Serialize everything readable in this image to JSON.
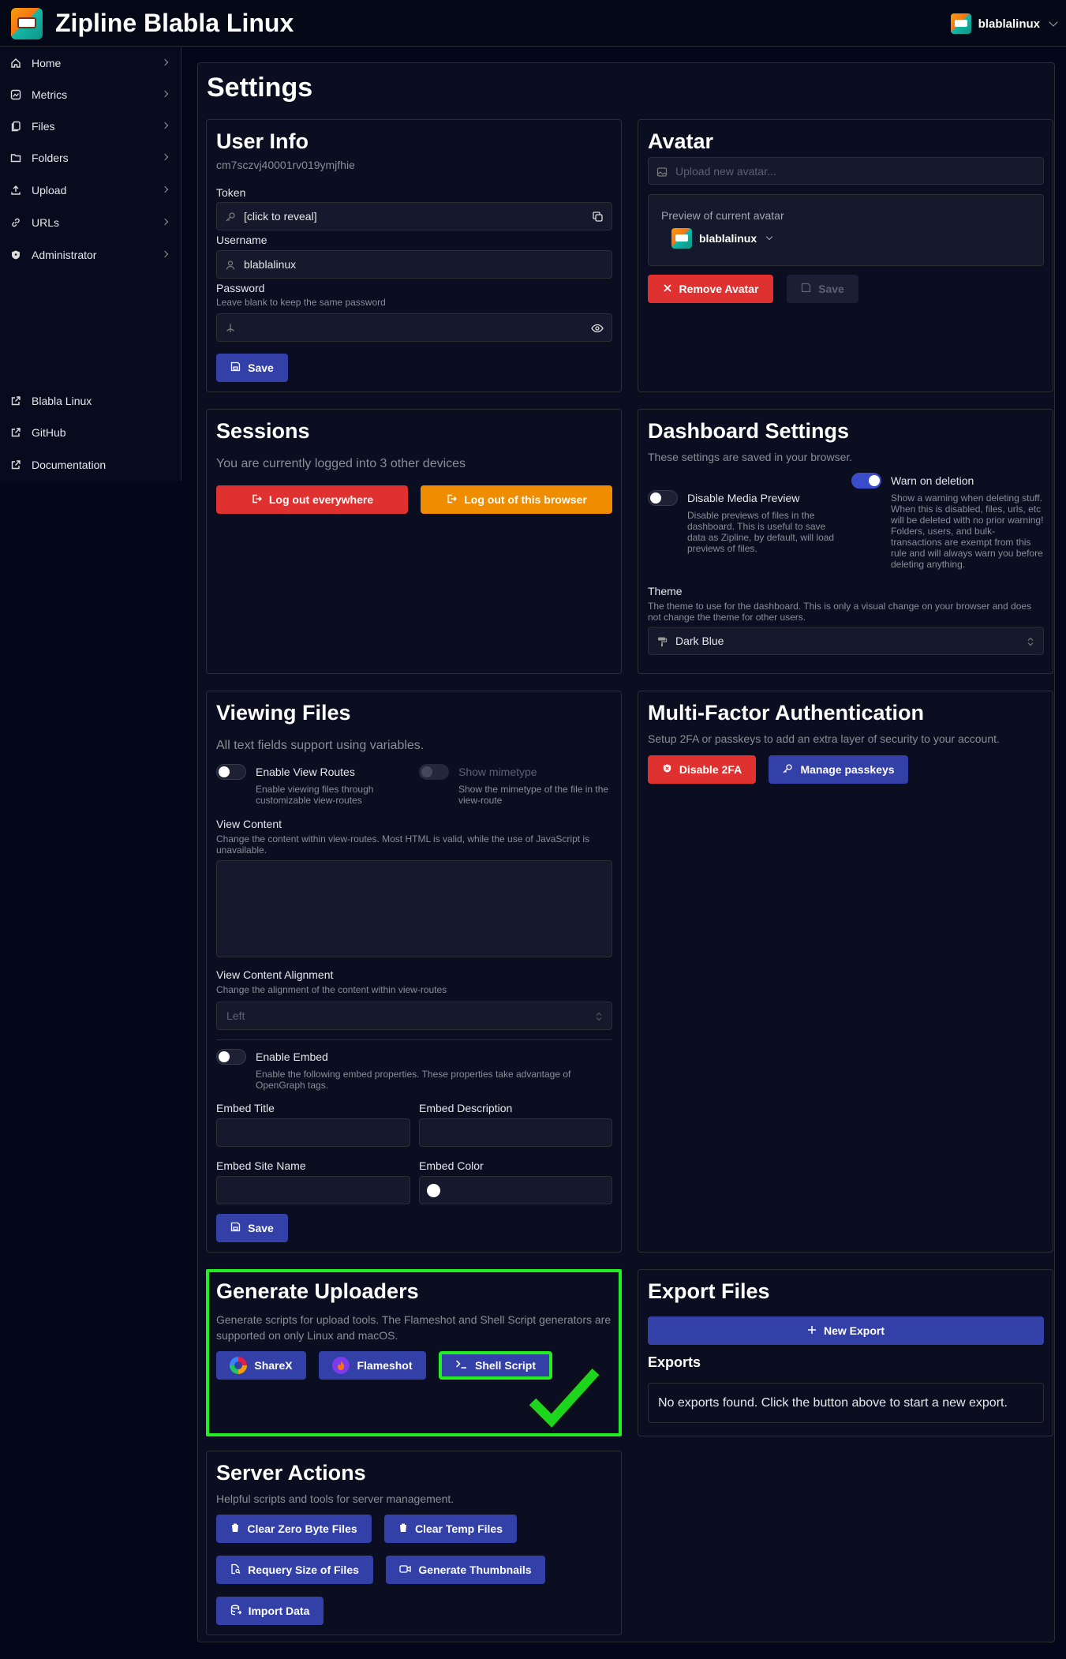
{
  "app": {
    "title": "Zipline Blabla Linux",
    "username": "blablalinux"
  },
  "sidebar": {
    "items": [
      {
        "label": "Home",
        "icon": "home-icon"
      },
      {
        "label": "Metrics",
        "icon": "chart-icon"
      },
      {
        "label": "Files",
        "icon": "files-icon"
      },
      {
        "label": "Folders",
        "icon": "folder-icon"
      },
      {
        "label": "Upload",
        "icon": "upload-icon"
      },
      {
        "label": "URLs",
        "icon": "link-icon"
      },
      {
        "label": "Administrator",
        "icon": "shield-icon"
      }
    ],
    "links": [
      {
        "label": "Blabla Linux",
        "icon": "external-link-icon"
      },
      {
        "label": "GitHub",
        "icon": "external-link-icon"
      },
      {
        "label": "Documentation",
        "icon": "external-link-icon"
      }
    ]
  },
  "settings": {
    "title": "Settings",
    "user_info": {
      "title": "User Info",
      "id": "cm7sczvj40001rv019ymjfhie",
      "token_label": "Token",
      "token_value": "[click to reveal]",
      "username_label": "Username",
      "username_value": "blablalinux",
      "password_label": "Password",
      "password_desc": "Leave blank to keep the same password",
      "save": "Save"
    },
    "avatar": {
      "title": "Avatar",
      "upload_placeholder": "Upload new avatar...",
      "preview_label": "Preview of current avatar",
      "preview_name": "blablalinux",
      "remove": "Remove Avatar",
      "save": "Save"
    },
    "sessions": {
      "title": "Sessions",
      "desc": "You are currently logged into 3 other devices",
      "logout_all": "Log out everywhere",
      "logout_browser": "Log out of this browser"
    },
    "dashboard": {
      "title": "Dashboard Settings",
      "desc": "These settings are saved in your browser.",
      "media_preview_label": "Disable Media Preview",
      "media_preview_desc": "Disable previews of files in the dashboard. This is useful to save data as Zipline, by default, will load previews of files.",
      "warn_label": "Warn on deletion",
      "warn_desc": "Show a warning when deleting stuff. When this is disabled, files, urls, etc will be deleted with no prior warning! Folders, users, and bulk-transactions are exempt from this rule and will always warn you before deleting anything.",
      "theme_label": "Theme",
      "theme_desc": "The theme to use for the dashboard. This is only a visual change on your browser and does not change the theme for other users.",
      "theme_value": "Dark Blue"
    },
    "viewing": {
      "title": "Viewing Files",
      "desc": "All text fields support using variables.",
      "routes_label": "Enable View Routes",
      "routes_desc": "Enable viewing files through customizable view-routes",
      "mime_label": "Show mimetype",
      "mime_desc": "Show the mimetype of the file in the view-route",
      "content_label": "View Content",
      "content_desc": "Change the content within view-routes. Most HTML is valid, while the use of JavaScript is unavailable.",
      "align_label": "View Content Alignment",
      "align_desc": "Change the alignment of the content within view-routes",
      "align_value": "Left",
      "embed_label": "Enable Embed",
      "embed_desc": "Enable the following embed properties. These properties take advantage of OpenGraph tags.",
      "embed_title": "Embed Title",
      "embed_description": "Embed Description",
      "embed_site": "Embed Site Name",
      "embed_color": "Embed Color",
      "save": "Save"
    },
    "mfa": {
      "title": "Multi-Factor Authentication",
      "desc": "Setup 2FA or passkeys to add an extra layer of security to your account.",
      "disable": "Disable 2FA",
      "passkeys": "Manage passkeys"
    },
    "uploaders": {
      "title": "Generate Uploaders",
      "desc": "Generate scripts for upload tools. The Flameshot and Shell Script generators are supported on only Linux and macOS.",
      "sharex": "ShareX",
      "flameshot": "Flameshot",
      "shell": "Shell Script",
      "highlight_color": "#22ee22"
    },
    "export": {
      "title": "Export Files",
      "new": "New Export",
      "subtitle": "Exports",
      "empty": "No exports found. Click the button above to start a new export."
    },
    "server": {
      "title": "Server Actions",
      "desc": "Helpful scripts and tools for server management.",
      "zero": "Clear Zero Byte Files",
      "temp": "Clear Temp Files",
      "requery": "Requery Size of Files",
      "thumbs": "Generate Thumbnails",
      "import": "Import Data"
    }
  },
  "colors": {
    "primary": "#3340a8",
    "danger": "#e03131",
    "warning": "#f08c00",
    "bg": "#04071a"
  }
}
